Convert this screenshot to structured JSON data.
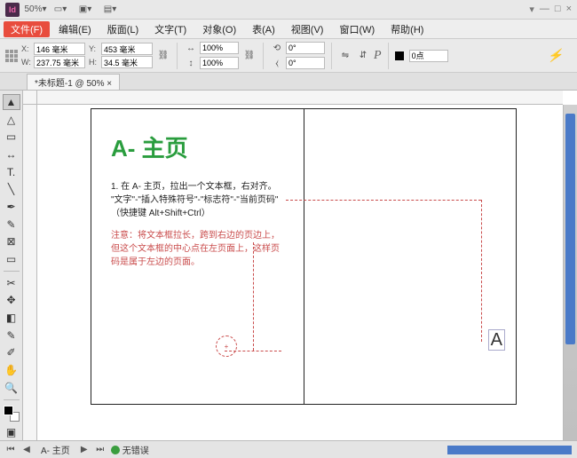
{
  "app": {
    "icon_label": "Id",
    "zoom_select": "50%"
  },
  "window_controls": {
    "help": "▾",
    "min": "—",
    "max": "□",
    "close": "×"
  },
  "menu": {
    "file": "文件(F)",
    "items": [
      "编辑(E)",
      "版面(L)",
      "文字(T)",
      "对象(O)",
      "表(A)",
      "视图(V)",
      "窗口(W)",
      "帮助(H)"
    ]
  },
  "controls": {
    "x": "146 毫米",
    "y": "453 毫米",
    "w": "237.75 毫米",
    "h": "34.5 毫米",
    "scale_x": "100%",
    "scale_y": "100%",
    "rotate": "0°",
    "shear": "0°",
    "stroke_size": "0点"
  },
  "tab": {
    "label": "*未标题-1 @ 50% ×"
  },
  "spread": {
    "title": "A- 主页",
    "step_num": "1.",
    "step_text": "在 A- 主页，拉出一个文本框，右对齐。",
    "menu_path": "\"文字\"-\"插入特殊符号\"-\"标志符\"-\"当前页码\"",
    "shortcut": "（快捷键 Alt+Shift+Ctrl）",
    "note": "注意：将文本框拉长，跨到右边的页边上，但这个文本框的中心点在左页面上，这样页码是属于左边的页面。",
    "marker": "A"
  },
  "status": {
    "nav_first": "⏮",
    "nav_prev": "◀",
    "page": "A- 主页",
    "nav_next": "▶",
    "nav_last": "⏭",
    "ok_text": "无错误"
  },
  "tool_names": [
    "selection",
    "direct-select",
    "page",
    "gap",
    "type",
    "line",
    "pen",
    "pencil",
    "rect-frame",
    "rect",
    "scissors",
    "free-transform",
    "gradient-swatch",
    "note",
    "eyedropper",
    "hand",
    "zoom",
    "swatches",
    "mode"
  ]
}
